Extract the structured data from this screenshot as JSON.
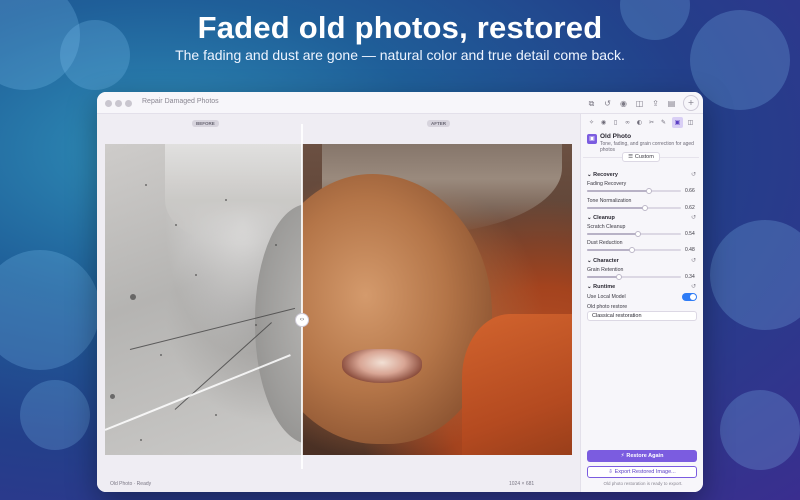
{
  "marketing": {
    "headline": "Faded old photos, restored",
    "subheadline": "The fading and dust are gone — natural color and true detail come back."
  },
  "window": {
    "title": "Repair Damaged Photos",
    "toolbar_icons": [
      "copy-icon",
      "undo-icon",
      "eye-icon",
      "compare-icon",
      "share-icon",
      "sidebar-icon",
      "add-icon"
    ]
  },
  "canvas": {
    "before_label": "BEFORE",
    "after_label": "AFTER",
    "status_left": "Old Photo · Ready",
    "status_right": "1024 × 681"
  },
  "panel": {
    "tabs": [
      "magic-icon",
      "eye-icon",
      "document-icon",
      "link-icon",
      "half-icon",
      "scissors-icon",
      "brush-icon",
      "photo-icon",
      "compare-icon"
    ],
    "active_tab_index": 7,
    "model": {
      "name": "Old Photo",
      "description": "Tone, fading, and grain correction for aged photos"
    },
    "custom_label": "Custom",
    "sections": {
      "recovery": "Recovery",
      "cleanup": "Cleanup",
      "character": "Character",
      "runtime": "Runtime"
    },
    "params": {
      "fading_recovery": {
        "label": "Fading Recovery",
        "value": "0.66",
        "fraction": 0.66
      },
      "tone_normalization": {
        "label": "Tone Normalization",
        "value": "0.62",
        "fraction": 0.62
      },
      "scratch_cleanup": {
        "label": "Scratch Cleanup",
        "value": "0.54",
        "fraction": 0.54
      },
      "dust_reduction": {
        "label": "Dust Reduction",
        "value": "0.48",
        "fraction": 0.48
      },
      "grain_retention": {
        "label": "Grain Retention",
        "value": "0.34",
        "fraction": 0.34
      }
    },
    "runtime": {
      "local_model_label": "Use Local Model",
      "local_model_on": true,
      "preset_label": "Old photo restore",
      "preset_value": "Classical restoration"
    },
    "restore_button": "Restore Again",
    "export_button": "Export Restored Image...",
    "footer_note": "Old photo restoration is ready to export."
  },
  "colors": {
    "accent": "#7b5ce0",
    "toggle_on": "#2f7cf6"
  }
}
